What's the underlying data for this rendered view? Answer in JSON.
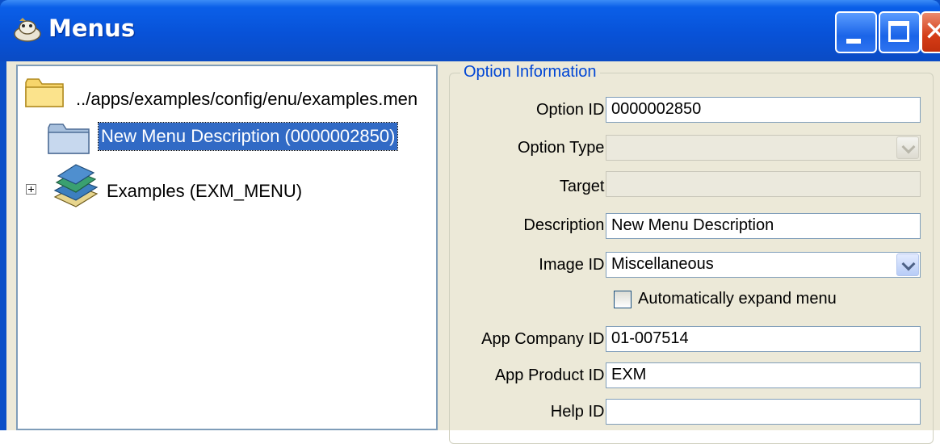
{
  "window": {
    "title": "Menus",
    "app_icon": "menus-app-icon",
    "controls": {
      "minimize": "minimize-icon",
      "maximize": "maximize-icon",
      "close": "✕"
    }
  },
  "tree": {
    "root": {
      "label": "../apps/examples/config/enu/examples.men",
      "icon": "folder-icon"
    },
    "selected_item": {
      "label": "New Menu Description (0000002850)",
      "icon": "folder-closed-icon"
    },
    "child": {
      "label": "Examples  (EXM_MENU)",
      "icon": "books-icon",
      "expander": "plus-icon"
    }
  },
  "form": {
    "group_title": "Option Information",
    "option_id": {
      "label": "Option ID:",
      "value": "0000002850"
    },
    "option_type": {
      "label": "Option Type:",
      "value": ""
    },
    "target": {
      "label": "Target:",
      "value": ""
    },
    "description": {
      "label": "Description:",
      "value": "New Menu Description"
    },
    "image_id": {
      "label": "Image ID:",
      "value": "Miscellaneous"
    },
    "auto_expand": {
      "label": "Automatically expand menu",
      "checked": false
    },
    "app_company_id": {
      "label": "App Company ID:",
      "value": "01-007514"
    },
    "app_product_id": {
      "label": "App Product ID:",
      "value": "EXM"
    },
    "help_id": {
      "label": "Help ID:",
      "value": ""
    }
  },
  "colors": {
    "title_bar": "#0852d8",
    "selection": "#316ac5",
    "group_title": "#0046d5",
    "panel": "#ece9d8"
  }
}
